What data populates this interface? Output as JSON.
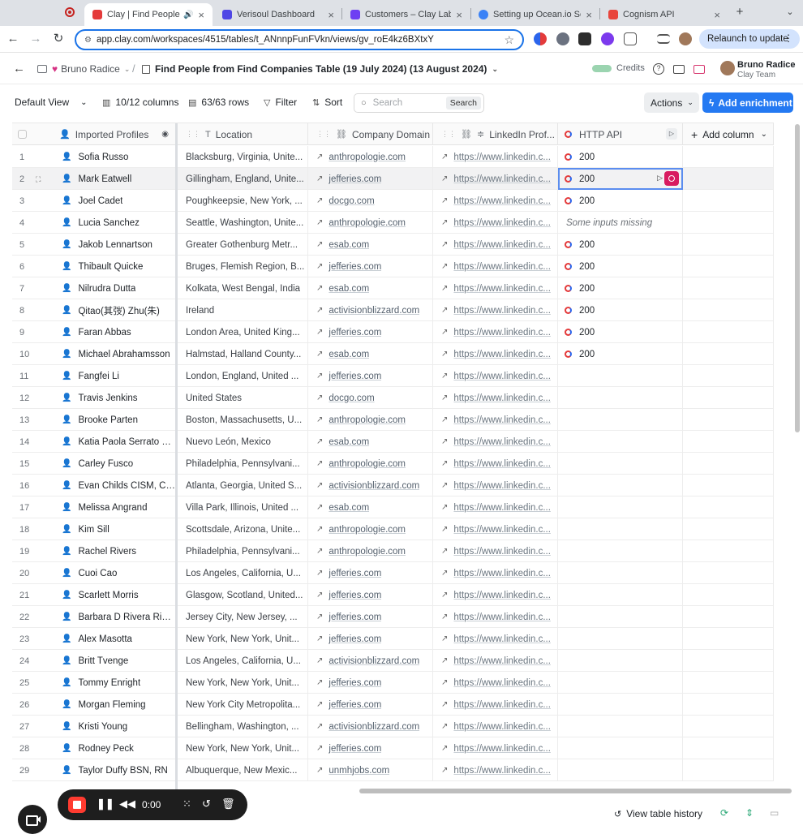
{
  "browser": {
    "tabs": [
      {
        "title": "Clay | Find People from Companies Table",
        "active": true,
        "favicon_color": "#e43b3b"
      },
      {
        "title": "Verisoul Dashboard",
        "active": false,
        "favicon_color": "#4f46e5"
      },
      {
        "title": "Customers – Clay Labs",
        "active": false,
        "favicon_color": "#6e3ff3"
      },
      {
        "title": "Setting up Ocean.io Search",
        "active": false,
        "favicon_color": "#3b82f6"
      },
      {
        "title": "Cognism API",
        "active": false,
        "favicon_color": "#e8453c"
      }
    ],
    "url": "app.clay.com/workspaces/4515/tables/t_ANnnpFunFVkn/views/gv_roE4kz6BXtxY",
    "relaunch_label": "Relaunch to update"
  },
  "app": {
    "workspace_name": "Bruno Radice",
    "table_title": "Find People from Find Companies Table (19 July 2024) (13 August 2024)",
    "credits_label": "Credits",
    "user_name": "Bruno Radice",
    "user_team": "Clay Team"
  },
  "toolbar": {
    "view_label": "Default View",
    "columns_label": "10/12 columns",
    "rows_label": "63/63 rows",
    "filter_label": "Filter",
    "sort_label": "Sort",
    "search_placeholder": "Search",
    "search_button": "Search",
    "actions_label": "Actions",
    "enrichment_label": "Add enrichment"
  },
  "columns": {
    "profiles": "Imported Profiles",
    "location": "Location",
    "domain": "Company Domain",
    "linkedin": "LinkedIn Prof...",
    "api": "HTTP API",
    "add": "Add column"
  },
  "rows": [
    {
      "n": "1",
      "name": "Sofia Russo",
      "loc": "Blacksburg, Virginia, Unite...",
      "domain": "anthropologie.com",
      "linkedin": "https://www.linkedin.c...",
      "api": "200"
    },
    {
      "n": "2",
      "name": "Mark Eatwell",
      "loc": "Gillingham, England, Unite...",
      "domain": "jefferies.com",
      "linkedin": "https://www.linkedin.c...",
      "api": "200"
    },
    {
      "n": "3",
      "name": "Joel Cadet",
      "loc": "Poughkeepsie, New York, ...",
      "domain": "docgo.com",
      "linkedin": "https://www.linkedin.c...",
      "api": "200"
    },
    {
      "n": "4",
      "name": "Lucia Sanchez",
      "loc": "Seattle, Washington, Unite...",
      "domain": "anthropologie.com",
      "linkedin": "https://www.linkedin.c...",
      "api": "Some inputs missing"
    },
    {
      "n": "5",
      "name": "Jakob Lennartson",
      "loc": "Greater Gothenburg Metr...",
      "domain": "esab.com",
      "linkedin": "https://www.linkedin.c...",
      "api": "200"
    },
    {
      "n": "6",
      "name": "Thibault Quicke",
      "loc": "Bruges, Flemish Region, B...",
      "domain": "jefferies.com",
      "linkedin": "https://www.linkedin.c...",
      "api": "200"
    },
    {
      "n": "7",
      "name": "Nilrudra Dutta",
      "loc": "Kolkata, West Bengal, India",
      "domain": "esab.com",
      "linkedin": "https://www.linkedin.c...",
      "api": "200"
    },
    {
      "n": "8",
      "name": "Qitao(其弢) Zhu(朱)",
      "loc": "Ireland",
      "domain": "activisionblizzard.com",
      "linkedin": "https://www.linkedin.c...",
      "api": "200"
    },
    {
      "n": "9",
      "name": "Faran Abbas",
      "loc": "London Area, United King...",
      "domain": "jefferies.com",
      "linkedin": "https://www.linkedin.c...",
      "api": "200"
    },
    {
      "n": "10",
      "name": "Michael Abrahamsson",
      "loc": "Halmstad, Halland County...",
      "domain": "esab.com",
      "linkedin": "https://www.linkedin.c...",
      "api": "200"
    },
    {
      "n": "11",
      "name": "Fangfei Li",
      "loc": "London, England, United ...",
      "domain": "jefferies.com",
      "linkedin": "https://www.linkedin.c...",
      "api": ""
    },
    {
      "n": "12",
      "name": "Travis Jenkins",
      "loc": "United States",
      "domain": "docgo.com",
      "linkedin": "https://www.linkedin.c...",
      "api": ""
    },
    {
      "n": "13",
      "name": "Brooke Parten",
      "loc": "Boston, Massachusetts, U...",
      "domain": "anthropologie.com",
      "linkedin": "https://www.linkedin.c...",
      "api": ""
    },
    {
      "n": "14",
      "name": "Katia Paola Serrato C...",
      "loc": "Nuevo León, Mexico",
      "domain": "esab.com",
      "linkedin": "https://www.linkedin.c...",
      "api": ""
    },
    {
      "n": "15",
      "name": "Carley Fusco",
      "loc": "Philadelphia, Pennsylvani...",
      "domain": "anthropologie.com",
      "linkedin": "https://www.linkedin.c...",
      "api": ""
    },
    {
      "n": "16",
      "name": "Evan Childs CISM, CR...",
      "loc": "Atlanta, Georgia, United S...",
      "domain": "activisionblizzard.com",
      "linkedin": "https://www.linkedin.c...",
      "api": ""
    },
    {
      "n": "17",
      "name": "Melissa Angrand",
      "loc": "Villa Park, Illinois, United ...",
      "domain": "esab.com",
      "linkedin": "https://www.linkedin.c...",
      "api": ""
    },
    {
      "n": "18",
      "name": "Kim Sill",
      "loc": "Scottsdale, Arizona, Unite...",
      "domain": "anthropologie.com",
      "linkedin": "https://www.linkedin.c...",
      "api": ""
    },
    {
      "n": "19",
      "name": "Rachel Rivers",
      "loc": "Philadelphia, Pennsylvani...",
      "domain": "anthropologie.com",
      "linkedin": "https://www.linkedin.c...",
      "api": ""
    },
    {
      "n": "20",
      "name": "Cuoi Cao",
      "loc": "Los Angeles, California, U...",
      "domain": "jefferies.com",
      "linkedin": "https://www.linkedin.c...",
      "api": ""
    },
    {
      "n": "21",
      "name": "Scarlett Morris",
      "loc": "Glasgow, Scotland, United...",
      "domain": "jefferies.com",
      "linkedin": "https://www.linkedin.c...",
      "api": ""
    },
    {
      "n": "22",
      "name": "Barbara D Rivera Ribe...",
      "loc": "Jersey City, New Jersey, ...",
      "domain": "jefferies.com",
      "linkedin": "https://www.linkedin.c...",
      "api": ""
    },
    {
      "n": "23",
      "name": "Alex Masotta",
      "loc": "New York, New York, Unit...",
      "domain": "jefferies.com",
      "linkedin": "https://www.linkedin.c...",
      "api": ""
    },
    {
      "n": "24",
      "name": "Britt Tvenge",
      "loc": "Los Angeles, California, U...",
      "domain": "activisionblizzard.com",
      "linkedin": "https://www.linkedin.c...",
      "api": ""
    },
    {
      "n": "25",
      "name": "Tommy Enright",
      "loc": "New York, New York, Unit...",
      "domain": "jefferies.com",
      "linkedin": "https://www.linkedin.c...",
      "api": ""
    },
    {
      "n": "26",
      "name": "Morgan Fleming",
      "loc": "New York City Metropolita...",
      "domain": "jefferies.com",
      "linkedin": "https://www.linkedin.c...",
      "api": ""
    },
    {
      "n": "27",
      "name": "Kristi Young",
      "loc": "Bellingham, Washington, ...",
      "domain": "activisionblizzard.com",
      "linkedin": "https://www.linkedin.c...",
      "api": ""
    },
    {
      "n": "28",
      "name": "Rodney Peck",
      "loc": "New York, New York, Unit...",
      "domain": "jefferies.com",
      "linkedin": "https://www.linkedin.c...",
      "api": ""
    },
    {
      "n": "29",
      "name": "Taylor Duffy BSN, RN",
      "loc": "Albuquerque, New Mexic...",
      "domain": "unmhjobs.com",
      "linkedin": "https://www.linkedin.c...",
      "api": ""
    }
  ],
  "recorder": {
    "time": "0:00"
  },
  "footer": {
    "history_label": "View table history"
  },
  "colors": {
    "accent": "#2479f2",
    "stop_red": "#d81b60"
  }
}
